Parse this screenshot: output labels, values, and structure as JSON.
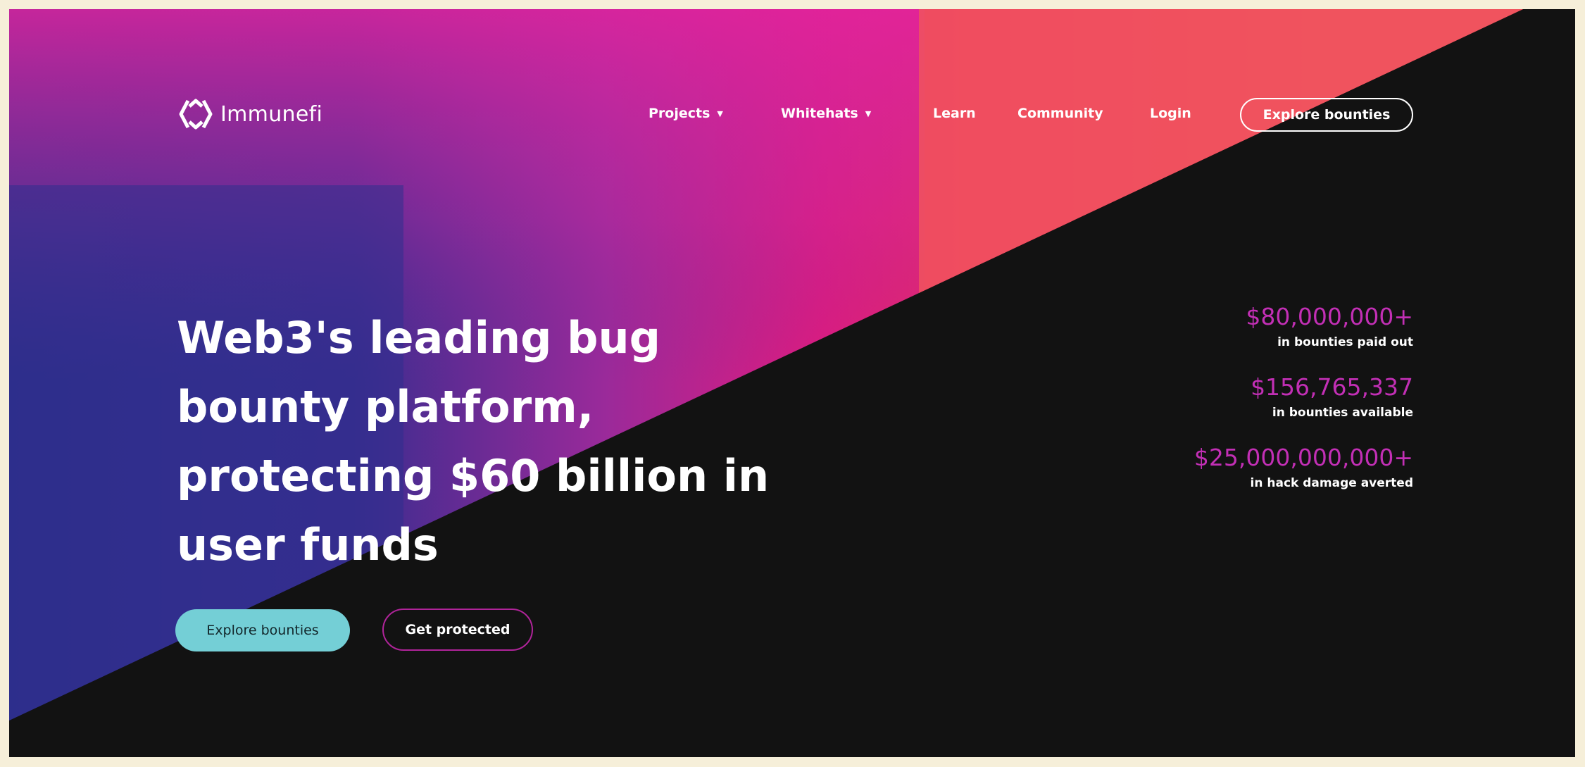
{
  "brand": {
    "name": "Immunefi",
    "logo_icon": "immunefi-logo-icon"
  },
  "nav": {
    "projects": "Projects",
    "whitehats": "Whitehats",
    "learn": "Learn",
    "community": "Community",
    "login": "Login",
    "cta": "Explore bounties",
    "dropdown_icon": "caret-down-icon"
  },
  "hero": {
    "headline_lines": [
      "Web3's leading bug",
      "bounty platform,",
      "protecting $60 billion in",
      "user funds"
    ],
    "primary_button": "Explore bounties",
    "secondary_button": "Get protected"
  },
  "stats": [
    {
      "value": "$80,000,000+",
      "label": "in bounties paid out"
    },
    {
      "value": "$156,765,337",
      "label": "in bounties available"
    },
    {
      "value": "$25,000,000,000+",
      "label": "in hack damage averted"
    }
  ],
  "colors": {
    "background_dark": "#121212",
    "accent_teal": "#74cfd6",
    "accent_magenta": "#c22fb5",
    "gradient_blue": "#2e2f8c",
    "gradient_pink": "#e6197e",
    "gradient_coral": "#f2525f"
  }
}
